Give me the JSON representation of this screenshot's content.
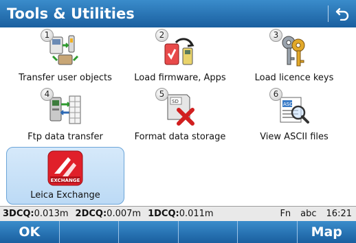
{
  "title": "Tools & Utilities",
  "tiles": [
    {
      "num": "1",
      "label": "Transfer user objects",
      "icon": "transfer-user-objects-icon"
    },
    {
      "num": "2",
      "label": "Load firmware, Apps",
      "icon": "load-firmware-icon"
    },
    {
      "num": "3",
      "label": "Load licence keys",
      "icon": "licence-keys-icon"
    },
    {
      "num": "4",
      "label": "Ftp data transfer",
      "icon": "ftp-transfer-icon"
    },
    {
      "num": "5",
      "label": "Format data storage",
      "icon": "format-storage-icon"
    },
    {
      "num": "6",
      "label": "View ASCII files",
      "icon": "view-ascii-icon"
    },
    {
      "num": "",
      "label": "Leica Exchange",
      "icon": "leica-exchange-icon",
      "selected": true,
      "badge": "EXCHANGE"
    }
  ],
  "status": {
    "q3_label": "3DCQ:",
    "q3_value": "0.013m",
    "q2_label": "2DCQ:",
    "q2_value": "0.007m",
    "q1_label": "1DCQ:",
    "q1_value": "0.011m",
    "fn": "Fn",
    "input_mode": "abc",
    "time": "16:21"
  },
  "softkeys": [
    "OK",
    "",
    "",
    "",
    "",
    "Map"
  ],
  "colors": {
    "accent": "#1a5f9f",
    "selected_bg": "#c8e1f8",
    "exchange_red": "#e0202a"
  }
}
